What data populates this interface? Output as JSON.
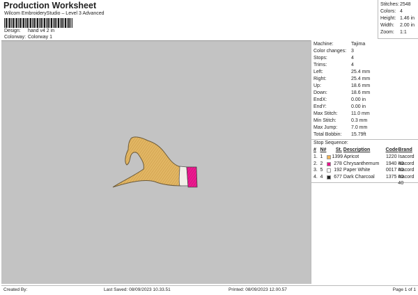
{
  "header": {
    "title": "Production Worksheet",
    "subtitle": "Wilcom EmbroideryStudio – Level 3 Advanced",
    "design_label": "Design:",
    "design_value": "hand v4 2 in",
    "colorway_label": "Colorway:",
    "colorway_value": "Colorway 1"
  },
  "stats": [
    {
      "k": "Stitches:",
      "v": "2548"
    },
    {
      "k": "Colors:",
      "v": "4"
    },
    {
      "k": "Height:",
      "v": "1.46 in"
    },
    {
      "k": "Width:",
      "v": "2.00 in"
    },
    {
      "k": "Zoom:",
      "v": "1:1"
    }
  ],
  "details": [
    {
      "k": "Machine:",
      "v": "Tajima"
    },
    {
      "k": "Color changes:",
      "v": "3"
    },
    {
      "k": "Stops:",
      "v": "4"
    },
    {
      "k": "Trims:",
      "v": "4"
    },
    {
      "k": "Left:",
      "v": "25.4 mm"
    },
    {
      "k": "Right:",
      "v": "25.4 mm"
    },
    {
      "k": "Up:",
      "v": "18.6 mm"
    },
    {
      "k": "Down:",
      "v": "18.6 mm"
    },
    {
      "k": "EndX:",
      "v": "0.00 in"
    },
    {
      "k": "EndY:",
      "v": "0.00 in"
    },
    {
      "k": "Max Stitch:",
      "v": "11.0 mm"
    },
    {
      "k": "Min Stitch:",
      "v": "0.3 mm"
    },
    {
      "k": "Max Jump:",
      "v": "7.0 mm"
    },
    {
      "k": "Total Bobbin:",
      "v": "15.79ft"
    }
  ],
  "stop_sequence": {
    "label": "Stop Sequence:",
    "headers": [
      "#",
      "N#",
      "St.",
      "Description",
      "Code",
      "Brand"
    ],
    "rows": [
      {
        "n": "1.",
        "nn": "1",
        "color": "#f2b65a",
        "st": "1399",
        "desc": "Apricot",
        "code": "1220",
        "brand": "Isacord 40"
      },
      {
        "n": "2.",
        "nn": "2",
        "color": "#e8128c",
        "st": "278",
        "desc": "Chrysanthemum",
        "code": "1940",
        "brand": "Isacord 40"
      },
      {
        "n": "3.",
        "nn": "5",
        "color": "#ffffff",
        "st": "192",
        "desc": "Paper White",
        "code": "0017",
        "brand": "Isacord 40"
      },
      {
        "n": "4.",
        "nn": "4",
        "color": "#222222",
        "st": "677",
        "desc": "Dark Charcoal",
        "code": "1375",
        "brand": "Isacord 40"
      }
    ]
  },
  "footer": {
    "created": "Created By:",
    "saved": "Last Saved: 08/09/2023 10.33.51",
    "printed": "Printed: 08/09/2023 12.00.57",
    "page": "Page 1 of 1"
  }
}
